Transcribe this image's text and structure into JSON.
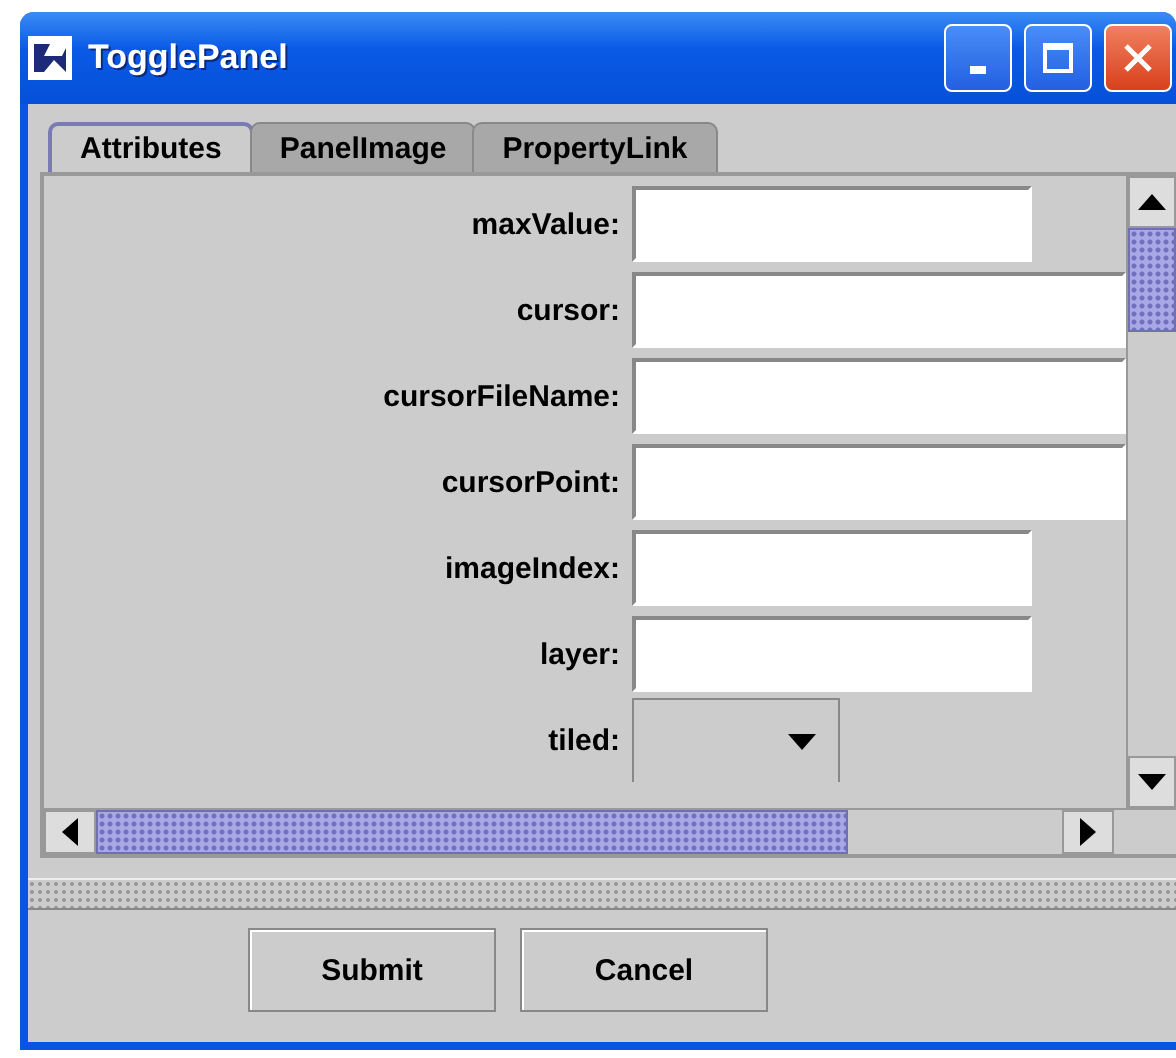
{
  "window": {
    "title": "TogglePanel"
  },
  "tabs": [
    {
      "label": "Attributes",
      "selected": true
    },
    {
      "label": "PanelImage",
      "selected": false
    },
    {
      "label": "PropertyLink",
      "selected": false
    }
  ],
  "fields": [
    {
      "label": "maxValue:",
      "kind": "text"
    },
    {
      "label": "cursor:",
      "kind": "text"
    },
    {
      "label": "cursorFileName:",
      "kind": "text"
    },
    {
      "label": "cursorPoint:",
      "kind": "text"
    },
    {
      "label": "imageIndex:",
      "kind": "text"
    },
    {
      "label": "layer:",
      "kind": "text"
    },
    {
      "label": "tiled:",
      "kind": "combo"
    }
  ],
  "buttons": [
    "Submit",
    "Cancel"
  ]
}
